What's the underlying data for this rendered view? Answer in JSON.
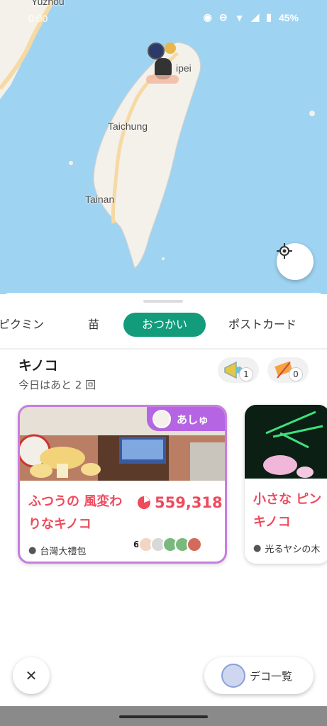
{
  "status": {
    "time": "0:00",
    "battery": "45%"
  },
  "map": {
    "labels": {
      "yuzhou": "Yuzhou",
      "taipei": "ipei",
      "taichung": "Taichung",
      "tainan": "Tainan"
    }
  },
  "tabs": [
    {
      "label": "ピクミン"
    },
    {
      "label": "苗"
    },
    {
      "label": "おつかい"
    },
    {
      "label": "ポストカード"
    }
  ],
  "section": {
    "title": "キノコ",
    "subtitle": "今日はあと 2 回",
    "items": [
      {
        "count": "1"
      },
      {
        "count": "0"
      }
    ]
  },
  "cards": [
    {
      "owner": "あしゅ",
      "name": "ふつうの 風変わりなキノコ",
      "hp": "559,318",
      "location": "台灣大禮包",
      "participants": "6"
    },
    {
      "name": "小さな ピンキノコ",
      "location": "光るヤシの木"
    }
  ],
  "buttons": {
    "deco": "デコ一覧"
  },
  "colors": {
    "accent": "#129c7b",
    "hp": "#ef4a5c",
    "owner": "#b565e3",
    "sea": "#9fd3f2"
  }
}
